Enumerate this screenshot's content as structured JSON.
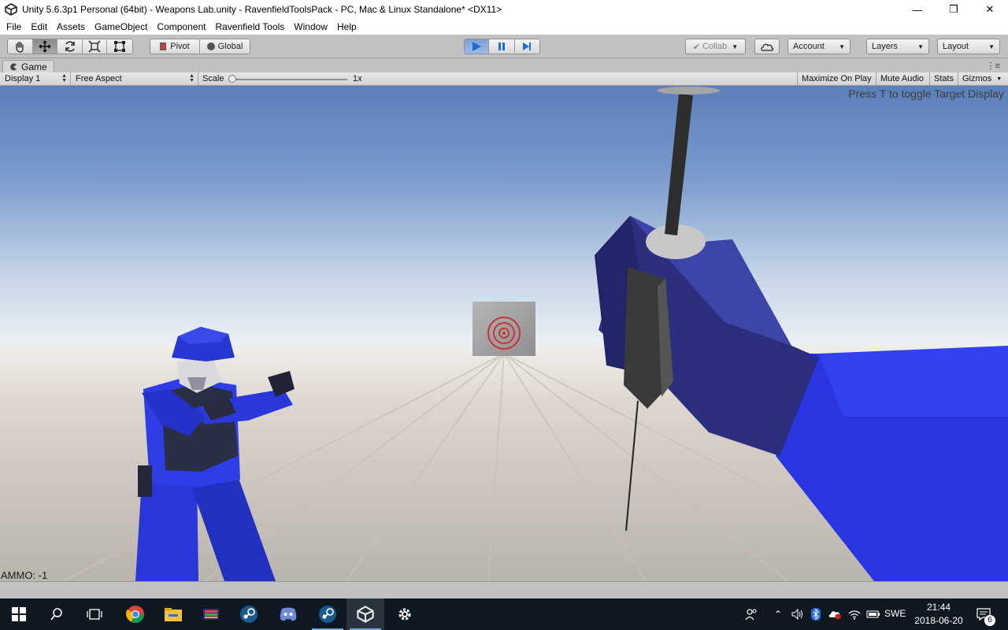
{
  "window": {
    "title": "Unity 5.6.3p1 Personal (64bit) - Weapons Lab.unity - RavenfieldToolsPack - PC, Mac & Linux Standalone* <DX11>",
    "controls": [
      "minimize-icon",
      "maximize-icon",
      "close-icon"
    ]
  },
  "menu": [
    "File",
    "Edit",
    "Assets",
    "GameObject",
    "Component",
    "Ravenfield Tools",
    "Window",
    "Help"
  ],
  "toolbar": {
    "tools": [
      "hand-tool-icon",
      "move-tool-icon",
      "rotate-tool-icon",
      "scale-tool-icon",
      "rect-tool-icon"
    ],
    "active_tool": "move-tool-icon",
    "pivot_label": "Pivot",
    "global_label": "Global",
    "play_state": "playing",
    "collab_label": "Collab",
    "account_label": "Account",
    "layers_label": "Layers",
    "layout_label": "Layout"
  },
  "game_tab": {
    "label": "Game",
    "display": "Display 1",
    "aspect": "Free Aspect",
    "scale_label": "Scale",
    "scale_value": "1x",
    "buttons": {
      "maximize": "Maximize On Play",
      "mute": "Mute Audio",
      "stats": "Stats",
      "gizmos": "Gizmos"
    }
  },
  "game_view": {
    "hint": "Press T to toggle Target Display",
    "ammo": "AMMO:  -1",
    "colors": {
      "sky_top": "#5a7fbb",
      "sky_horizon": "#eaf0f5",
      "ground": "#cfc9c2",
      "team_blue": "#2b3ae0"
    }
  },
  "taskbar": {
    "apps": [
      "windows-start-icon",
      "search-icon",
      "task-view-icon",
      "chrome-icon",
      "file-explorer-icon",
      "app-icon",
      "steam-icon",
      "discord-icon",
      "steam-icon",
      "unity-icon",
      "settings-icon"
    ],
    "language": "SWE",
    "time": "21:44",
    "date": "2018-06-20",
    "notifications": "6"
  }
}
